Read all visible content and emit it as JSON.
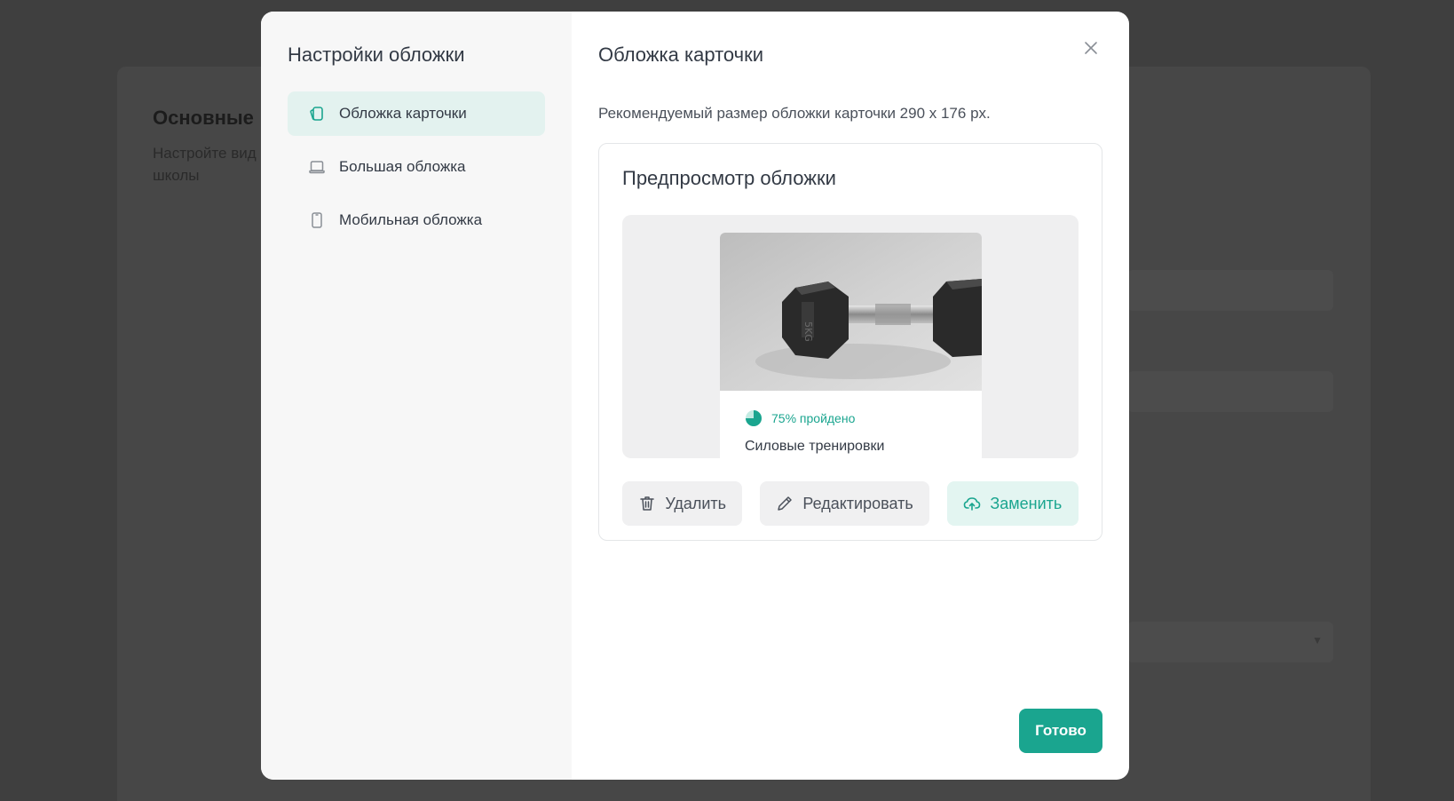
{
  "background": {
    "title": "Основные",
    "description": "Настройте вид школы"
  },
  "modal": {
    "sidebar": {
      "title": "Настройки обложки",
      "items": [
        {
          "label": "Обложка карточки",
          "icon": "card-cover-icon",
          "active": true
        },
        {
          "label": "Большая обложка",
          "icon": "laptop-icon",
          "active": false
        },
        {
          "label": "Мобильная обложка",
          "icon": "mobile-icon",
          "active": false
        }
      ]
    },
    "main": {
      "title": "Обложка карточки",
      "close_icon": "close-icon",
      "recommendation": "Рекомендуемый размер обложки карточки 290 х 176 px.",
      "preview": {
        "title": "Предпросмотр обложки",
        "image": "dumbbell-photo",
        "progress_percent": 75,
        "progress_label": "75% пройдено",
        "course_title": "Силовые тренировки"
      },
      "buttons": {
        "delete_label": "Удалить",
        "edit_label": "Редактировать",
        "replace_label": "Заменить"
      },
      "done_label": "Готово"
    }
  },
  "colors": {
    "accent": "#1aa58f",
    "accent_light": "#e3f5f1",
    "overlay": "#3f3f3f"
  }
}
